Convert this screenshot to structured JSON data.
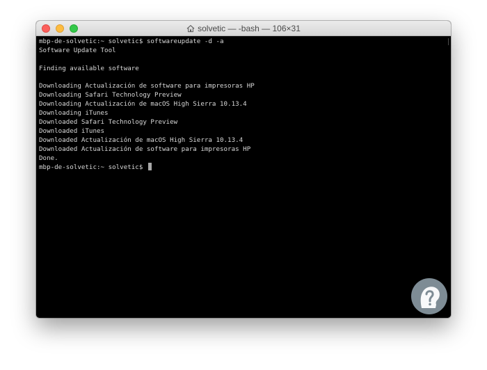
{
  "window": {
    "title": "solvetic — -bash — 106×31"
  },
  "terminal": {
    "lines": [
      "mbp-de-solvetic:~ solvetic$ softwareupdate -d -a",
      "Software Update Tool",
      "",
      "Finding available software",
      "",
      "Downloading Actualización de software para impresoras HP",
      "Downloading Safari Technology Preview",
      "Downloading Actualización de macOS High Sierra 10.13.4",
      "Downloading iTunes",
      "Downloaded Safari Technology Preview",
      "Downloaded iTunes",
      "Downloaded Actualización de macOS High Sierra 10.13.4",
      "Downloaded Actualización de software para impresoras HP",
      "Done."
    ],
    "prompt": "mbp-de-solvetic:~ solvetic$ "
  },
  "colors": {
    "terminal_background": "#000000",
    "terminal_text": "#d8d8d8",
    "close_button": "#fc605c",
    "minimize_button": "#fdbc40",
    "zoom_button": "#34c84a",
    "watermark": "#7e8c95"
  },
  "icons": {
    "title_icon": "home-icon",
    "watermark_icon": "question-mark-head-logo"
  }
}
